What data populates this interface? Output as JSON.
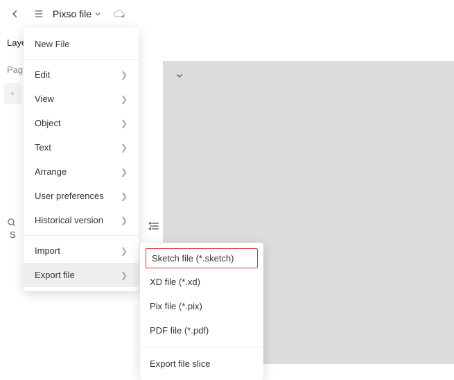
{
  "header": {
    "file_title": "Pixso file"
  },
  "sidebar": {
    "tab_label": "Laye",
    "pages_label": "Pag",
    "search_placeholder": "S"
  },
  "menu": {
    "new_file": "New File",
    "edit": "Edit",
    "view": "View",
    "object": "Object",
    "text": "Text",
    "arrange": "Arrange",
    "user_preferences": "User preferences",
    "historical_version": "Historical version",
    "import": "Import",
    "export_file": "Export file"
  },
  "submenu": {
    "sketch": "Sketch file (*.sketch)",
    "xd": "XD file (*.xd)",
    "pix": "Pix file (*.pix)",
    "pdf": "PDF file (*.pdf)",
    "slice": "Export file slice"
  }
}
